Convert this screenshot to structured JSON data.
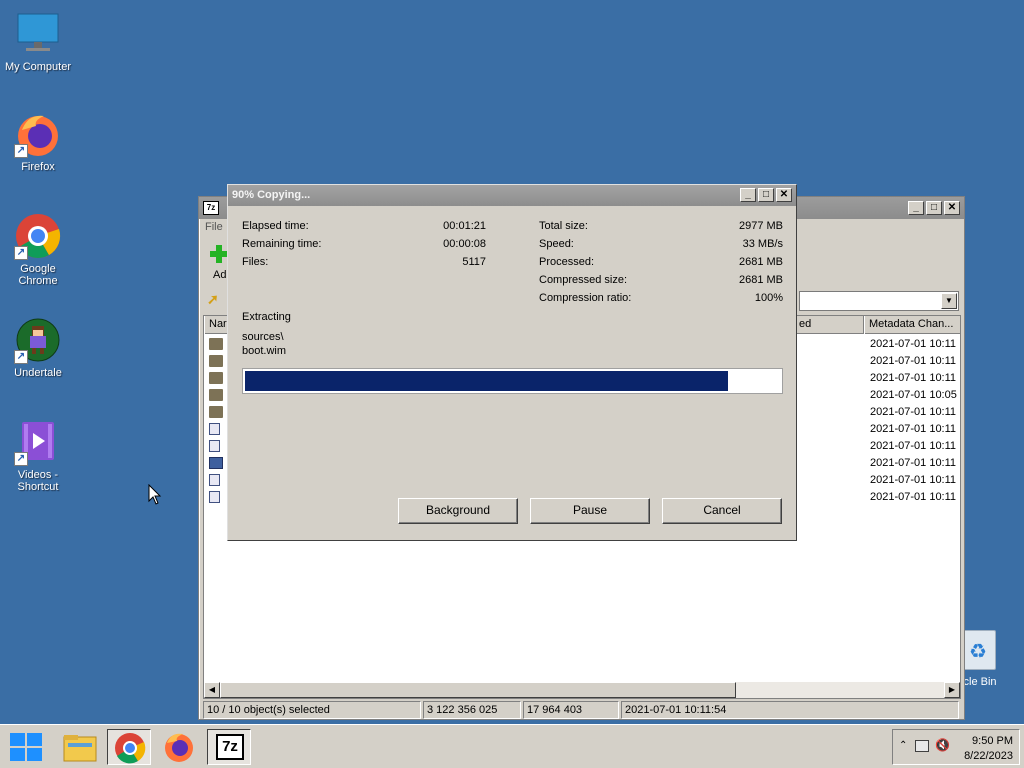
{
  "desktop": {
    "icons": [
      {
        "label": "My Computer"
      },
      {
        "label": "Firefox"
      },
      {
        "label": "Google Chrome"
      },
      {
        "label": "Undertale"
      },
      {
        "label": "Videos - Shortcut"
      }
    ],
    "recycle_bin_label": "ycle Bin"
  },
  "main_window": {
    "icon_text": "7z",
    "menu_label": "File",
    "add_label": "Ad",
    "columns": [
      {
        "label": "Nar"
      },
      {
        "label": "ed"
      },
      {
        "label": "Metadata Chan..."
      }
    ],
    "rows": [
      {
        "type": "folder",
        "date": "2021-07-01 10:11"
      },
      {
        "type": "folder",
        "date": "2021-07-01 10:11"
      },
      {
        "type": "folder",
        "date": "2021-07-01 10:11"
      },
      {
        "type": "folder",
        "date": "2021-07-01 10:05"
      },
      {
        "type": "folder",
        "date": "2021-07-01 10:11"
      },
      {
        "type": "file",
        "date": "2021-07-01 10:11"
      },
      {
        "type": "file",
        "date": "2021-07-01 10:11"
      },
      {
        "type": "wim",
        "date": "2021-07-01 10:11"
      },
      {
        "type": "file",
        "date": "2021-07-01 10:11"
      },
      {
        "type": "file",
        "date": "2021-07-01 10:11"
      }
    ],
    "status": {
      "selected": "10 / 10 object(s) selected",
      "size": "3 122 356 025",
      "packed": "17 964 403",
      "modified": "2021-07-01 10:11:54"
    }
  },
  "dialog": {
    "title": "90% Copying...",
    "elapsed_label": "Elapsed time:",
    "elapsed_value": "00:01:21",
    "remaining_label": "Remaining time:",
    "remaining_value": "00:00:08",
    "files_label": "Files:",
    "files_value": "5117",
    "total_size_label": "Total size:",
    "total_size_value": "2977 MB",
    "speed_label": "Speed:",
    "speed_value": "33 MB/s",
    "processed_label": "Processed:",
    "processed_value": "2681 MB",
    "compressed_size_label": "Compressed size:",
    "compressed_size_value": "2681 MB",
    "compression_ratio_label": "Compression ratio:",
    "compression_ratio_value": "100%",
    "operation": "Extracting",
    "current_path": "sources\\",
    "current_file": "boot.wim",
    "progress_fraction": 0.9,
    "buttons": {
      "background": "Background",
      "pause": "Pause",
      "cancel": "Cancel"
    }
  },
  "taskbar": {
    "time": "9:50 PM",
    "date": "8/22/2023",
    "active_app_icon_text": "7z"
  },
  "colors": {
    "desktop": "#3a6ea5",
    "progress_fill": "#0a246a",
    "window_face": "#d4d0c8"
  }
}
